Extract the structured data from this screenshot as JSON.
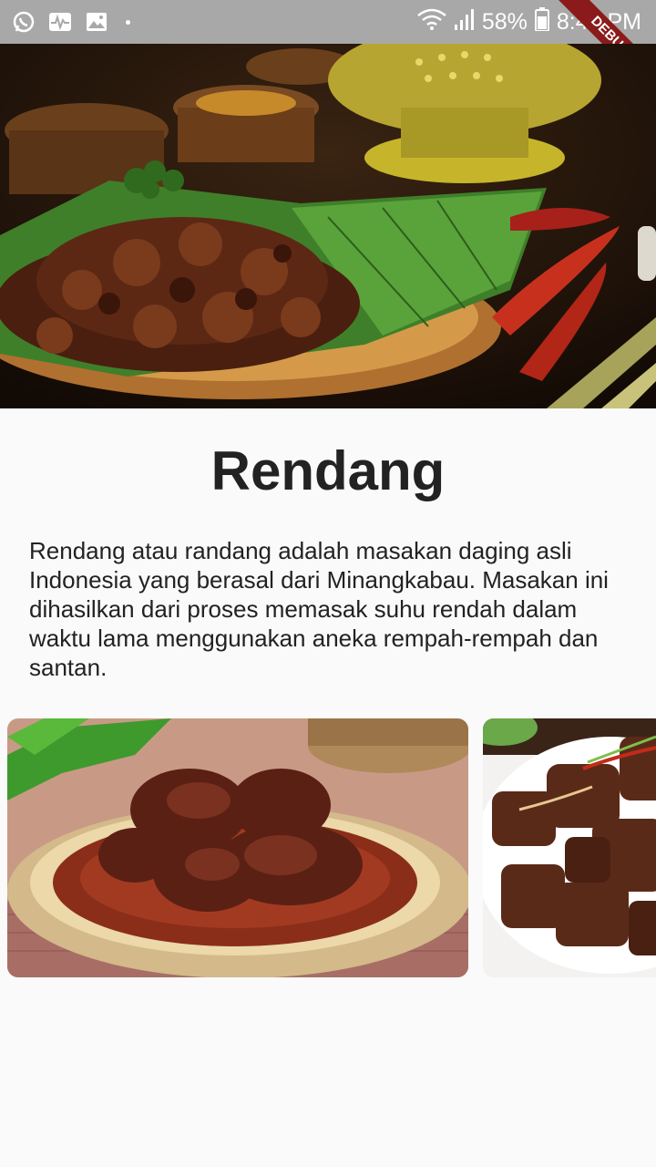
{
  "status_bar": {
    "battery": "58%",
    "time": "8:46 PM",
    "icons": [
      "whatsapp-icon",
      "activity-icon",
      "image-icon",
      "notification-dot-icon",
      "wifi-icon",
      "signal-icon",
      "battery-icon"
    ]
  },
  "debug_banner": "DEBUG",
  "recipe": {
    "title": "Rendang",
    "description": "Rendang atau randang adalah masakan daging asli Indonesia yang berasal dari Minangkabau. Masakan ini dihasilkan dari proses memasak suhu rendah dalam waktu lama menggunakan aneka rempah-rempah dan santan."
  },
  "gallery": {
    "images": [
      "rendang-photo-plate",
      "rendang-photo-white-plate"
    ]
  }
}
